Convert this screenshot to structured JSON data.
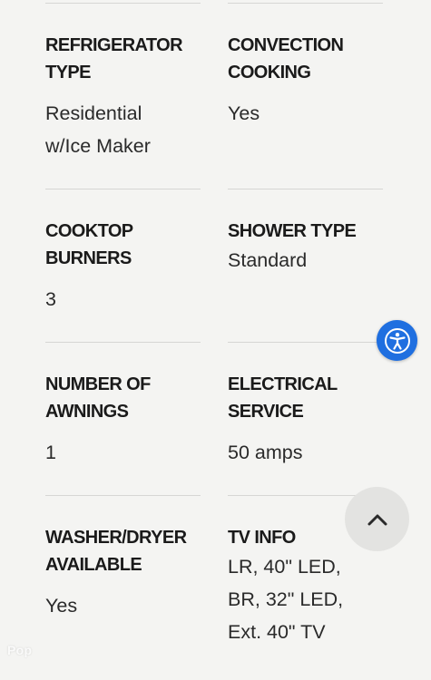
{
  "specs": [
    {
      "label": "REFRIGERATOR TYPE",
      "value": "Residential\nw/Ice Maker"
    },
    {
      "label": "CONVECTION COOKING",
      "value": "Yes"
    },
    {
      "label": "COOKTOP BURNERS",
      "value": "3"
    },
    {
      "label": "SHOWER TYPE",
      "value": "Standard"
    },
    {
      "label": "NUMBER OF AWNINGS",
      "value": "1"
    },
    {
      "label": "ELECTRICAL SERVICE",
      "value": "50 amps"
    },
    {
      "label": "WASHER/DRYER AVAILABLE",
      "value": "Yes"
    },
    {
      "label": "TV INFO",
      "value": "LR, 40\" LED,\nBR, 32\" LED,\nExt. 40\" TV"
    }
  ],
  "icons": {
    "accessibility": "accessibility-icon",
    "scroll_top": "chevron-up-icon"
  },
  "colors": {
    "background": "#f4f4f2",
    "accessibility_button": "#1f6fe0",
    "scroll_top_button": "#e3e3e1",
    "divider": "#d6d6d4"
  },
  "watermark": "Pop"
}
